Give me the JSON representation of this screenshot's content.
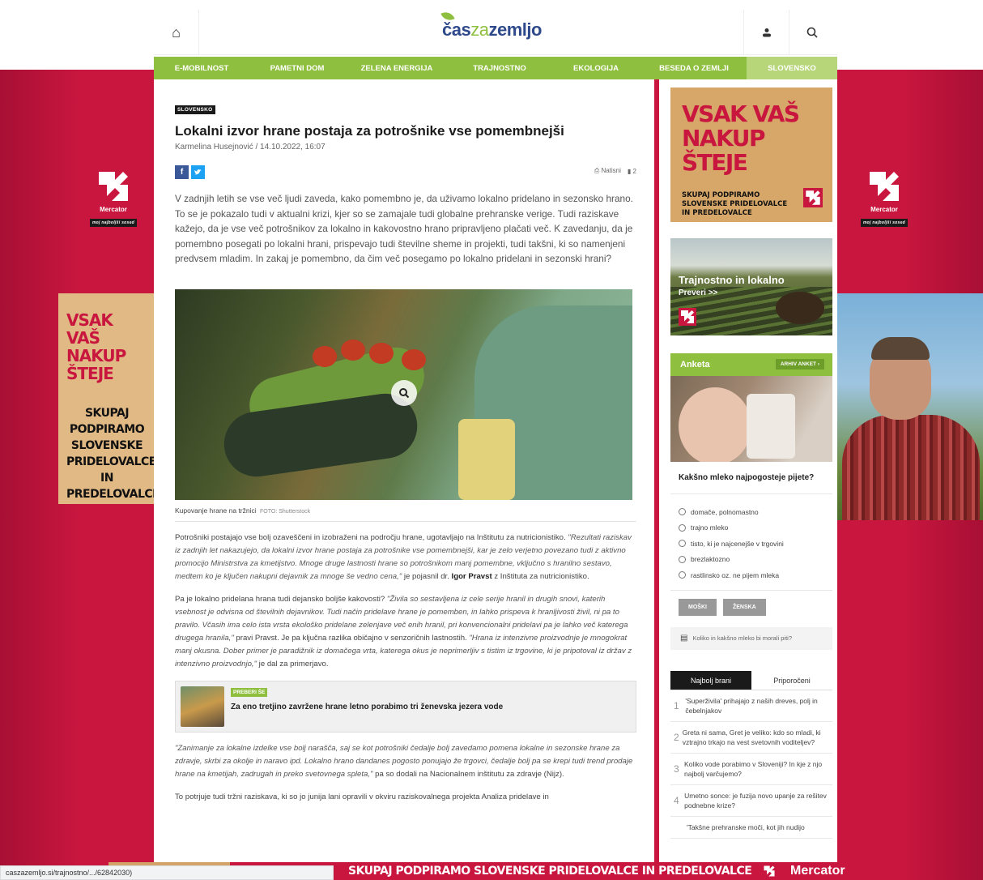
{
  "header": {
    "brand_cas": "čas",
    "brand_za": "za",
    "brand_zemljo": "zemljo",
    "home_icon": "home-icon",
    "user_icon": "user-icon",
    "search_icon": "search-icon"
  },
  "nav": {
    "items": [
      {
        "label": "E-MOBILNOST"
      },
      {
        "label": "PAMETNI DOM"
      },
      {
        "label": "ZELENA ENERGIJA"
      },
      {
        "label": "TRAJNOSTNO"
      },
      {
        "label": "EKOLOGIJA"
      },
      {
        "label": "BESEDA O ZEMLJI"
      },
      {
        "label": "SLOVENSKO"
      }
    ],
    "active": "SLOVENSKO"
  },
  "ads": {
    "left_slogan_1": "VSAK VAŠ",
    "left_slogan_2": "NAKUP ŠTEJE",
    "left_slogan_3": "SKUPAJ PODPIRAMO SLOVENSKE PRIDELOVALCE IN PREDELOVALCE",
    "mercator_wordmark": "Mercator",
    "mercator_tag": "moj najboljši sosed",
    "sidebar_slogan_1": "VSAK VAŠ",
    "sidebar_slogan_2": "NAKUP ŠTEJE",
    "sidebar_slogan_3": "SKUPAJ PODPIRAMO SLOVENSKE PRIDELOVALCE IN PREDELOVALCE",
    "sidebar2_title": "Trajnostno in lokalno",
    "sidebar2_cta": "Preveri >>",
    "bottom_text": "SKUPAJ PODPIRAMO SLOVENSKE PRIDELOVALCE IN PREDELOVALCE",
    "bottom_brand": "Mercator"
  },
  "article": {
    "tag": "SLOVENSKO",
    "title": "Lokalni izvor hrane postaja za potrošnike vse pomembnejši",
    "byline": "Karmelina Husejnović / 14.10.2022, 16:07",
    "print_label": "Natisni",
    "comments_count": "2",
    "lead": "V zadnjih letih se vse več ljudi zaveda, kako pomembno je, da uživamo lokalno pridelano in sezonsko hrano. To se je pokazalo tudi v aktualni krizi, kjer so se zamajale tudi globalne prehranske verige. Tudi raziskave kažejo, da je vse več potrošnikov za lokalno in kakovostno hrano pripravljeno plačati več. K zavedanju, da je pomembno posegati po lokalni hrani, prispevajo tudi številne sheme in projekti, tudi takšni, ki so namenjeni predvsem mladim. In zakaj je pomembno, da čim več posegamo po lokalno pridelani in sezonski hrani?",
    "photo_caption": "Kupovanje hrane na tržnici",
    "photo_credit": "FOTO: Shutterstock",
    "p1_plain": "Potrošniki postajajo vse bolj ozaveščeni in izobraženi na področju hrane, ugotavljajo na Inštitutu za nutricionistiko. ",
    "p1_quote": "\"Rezultati raziskav iz zadnjih let nakazujejo, da lokalni izvor hrane postaja za potrošnike vse pomembnejši, kar je zelo verjetno povezano tudi z aktivno promocijo Ministrstva za kmetijstvo. Mnoge druge lastnosti hrane so potrošnikom manj pomembne, vključno s hranilno sestavo, medtem ko je ključen nakupni dejavnik za mnoge še vedno cena,\"",
    "p1_tail1": " je pojasnil dr. ",
    "p1_name": "Igor Pravst",
    "p1_tail2": " z Inštituta za nutricionistiko.",
    "p2_plain1": "Pa je lokalno pridelana hrana tudi dejansko boljše kakovosti? ",
    "p2_quote1": "\"Živila so sestavljena iz cele serije hranil in drugih snovi, katerih vsebnost je odvisna od številnih dejavnikov. Tudi način pridelave hrane je pomemben, in lahko prispeva k hranljivosti živil, ni pa to pravilo. Včasih ima celo ista vrsta ekološko pridelane zelenjave več enih hranil, pri konvencionalni pridelavi pa je lahko več katerega drugega hranila,\"",
    "p2_plain2": " pravi Pravst. Je pa ključna razlika običajno v senzoričnih lastnostih. ",
    "p2_quote2": "\"Hrana iz intenzivne proizvodnje je mnogokrat manj okusna. Dober primer je paradižnik iz domačega vrta, katerega okus je neprimerljiv s tistim iz trgovine, ki je pripotoval iz držav z intenzivno proizvodnjo,\"",
    "p2_plain3": " je dal za primerjavo.",
    "readmore_label": "PREBERI ŠE",
    "readmore_title": "Za eno tretjino zavržene hrane letno porabimo tri ženevska jezera vode",
    "p3_quote": "\"Zanimanje za lokalne izdelke vse bolj narašča, saj se kot potrošniki čedalje bolj zavedamo pomena lokalne in sezonske hrane za zdravje, skrbi za okolje in naravo ipd. Lokalno hrano dandanes pogosto ponujajo že trgovci, čedalje bolj pa se krepi tudi trend prodaje hrane na kmetijah, zadrugah in preko svetovnega spleta,\"",
    "p3_plain": " pa so dodali na Nacionalnem inštitutu za zdravje (Nijz).",
    "p4_plain": "To potrjuje tudi tržni raziskava, ki so jo junija lani opravili v okviru raziskovalnega projekta Analiza pridelave in"
  },
  "poll": {
    "title": "Anketa",
    "archive": "ARHIV ANKET",
    "question": "Kakšno mleko najpogosteje pijete?",
    "options": [
      "domače, polnomastno",
      "trajno mleko",
      "tisto, ki je najcenejše v trgovini",
      "brezlaktozno",
      "rastlinsko oz. ne pijem mleka"
    ],
    "btn_male": "MOŠKI",
    "btn_female": "ŽENSKA",
    "link": "Koliko in kakšno mleko bi morali piti?"
  },
  "popular": {
    "tab_1": "Najbolj brani",
    "tab_2": "Priporočeni",
    "items": [
      {
        "n": "1",
        "t": "'Superživila' prihajajo z naših dreves, polj in čebelnjakov"
      },
      {
        "n": "2",
        "t": "Greta ni sama, Gret je veliko: kdo so mladi, ki vztrajno trkajo na vest svetovnih voditeljev?"
      },
      {
        "n": "3",
        "t": "Koliko vode porabimo v Sloveniji? In kje z njo najbolj varčujemo?"
      },
      {
        "n": "4",
        "t": "Umetno sonce: je fuzija novo upanje za rešitev podnebne krize?"
      },
      {
        "n": "",
        "t": "'Takšne prehranske moči, kot jih nudijo"
      }
    ]
  },
  "statusbar": {
    "url": "caszazemljo.si/trajnostno/.../62842030)"
  },
  "colors": {
    "brand_green": "#8fbf3f",
    "brand_blue": "#2f4a8a",
    "mercator_red": "#c8163f"
  }
}
